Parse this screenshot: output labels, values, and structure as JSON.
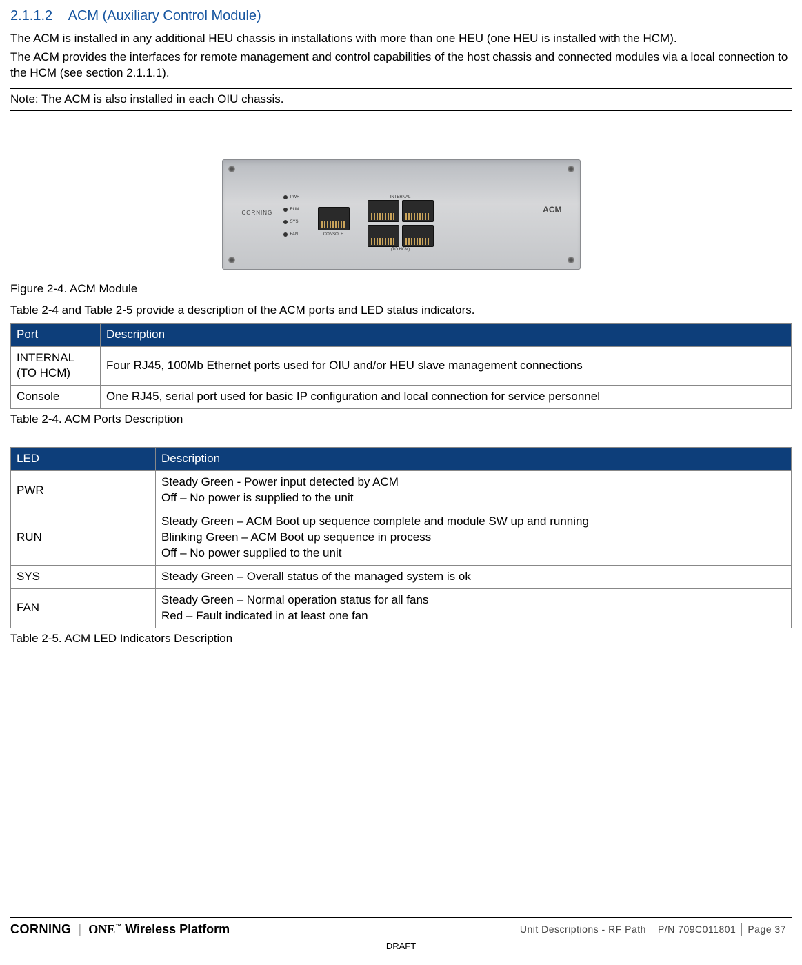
{
  "section": {
    "number": "2.1.1.2",
    "title": "ACM (Auxiliary Control Module)"
  },
  "paragraphs": {
    "p1": "The ACM is installed in any additional HEU chassis in installations with more than one HEU (one HEU is installed with the HCM).",
    "p2": "The ACM provides the interfaces for remote management and control capabilities of the host chassis and connected modules via a local connection to the HCM (see section 2.1.1.1)."
  },
  "note": "Note: The ACM is also installed in each OIU chassis.",
  "device": {
    "brand": "CORNING",
    "leds": [
      "PWR",
      "RUN",
      "SYS",
      "FAN"
    ],
    "console_label": "CONSOLE",
    "quad_top": "INTERNAL",
    "quad_bot": "(TO HCM)",
    "acm": "ACM"
  },
  "figure_caption": "Figure 2-4. ACM Module",
  "inter_para": "Table 2-4 and Table 2-5 provide a description of the ACM ports and LED status indicators.",
  "ports_table": {
    "headers": [
      "Port",
      "Description"
    ],
    "rows": [
      {
        "port": "INTERNAL (TO HCM)",
        "desc": "Four RJ45, 100Mb Ethernet ports used for OIU and/or HEU slave management connections"
      },
      {
        "port": "Console",
        "desc": "One RJ45, serial port used for basic IP configuration and local connection for service personnel"
      }
    ],
    "caption": "Table 2-4. ACM Ports Description"
  },
  "led_table": {
    "headers": [
      "LED",
      "Description"
    ],
    "rows": [
      {
        "led": "PWR",
        "desc": "Steady Green - Power input detected by ACM\nOff – No power is supplied to the unit"
      },
      {
        "led": "RUN",
        "desc": "Steady Green – ACM Boot up sequence complete and module SW up and running\nBlinking Green – ACM Boot up sequence in process\nOff – No power supplied to the unit"
      },
      {
        "led": "SYS",
        "desc": "Steady Green – Overall status of the managed system is ok"
      },
      {
        "led": "FAN",
        "desc": "Steady Green – Normal operation status for all fans\nRed – Fault indicated in at least one fan"
      }
    ],
    "caption": "Table 2-5. ACM LED Indicators Description"
  },
  "footer": {
    "brand1": "CORNING",
    "brand2": "ONE",
    "tm": "™",
    "brand3": "Wireless Platform",
    "section": "Unit Descriptions - RF Path",
    "pn": "P/N 709C011801",
    "page": "Page 37",
    "draft": "DRAFT"
  }
}
